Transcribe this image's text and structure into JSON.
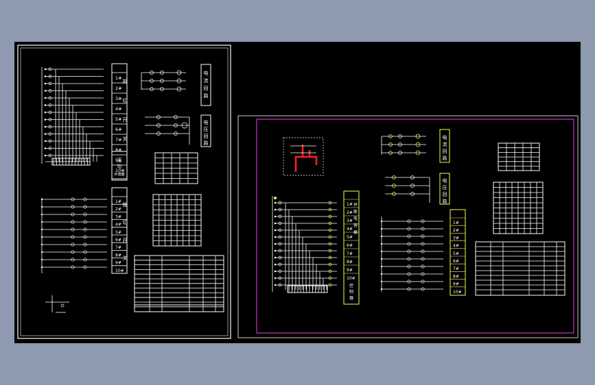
{
  "sheet_left": {
    "bus_rows": 13,
    "contact_rows": 10,
    "current_circuit_label": "电流回路",
    "voltage_circuit_label": "电压回路",
    "switch_label": "无功补偿器",
    "row_labels": [
      "1#",
      "2#",
      "3#",
      "4#",
      "5#",
      "6#",
      "7#",
      "8#",
      "9#",
      "10#"
    ],
    "top_block_chars": [
      "投",
      "切",
      "开",
      "关"
    ],
    "bottom_block_chars": [
      "投",
      "切",
      "开",
      "关"
    ]
  },
  "sheet_right": {
    "bus_rows": 13,
    "contact_rows": 10,
    "current_circuit_label": "电流回路",
    "voltage_circuit_label": "电压回路",
    "vertical_label_a": "并联电容器",
    "vertical_label_b": "控制器",
    "row_labels": [
      "1#",
      "2#",
      "3#",
      "4#",
      "5#",
      "6#",
      "7#",
      "8#",
      "9#",
      "10#"
    ]
  },
  "colors": {
    "page_bg": "#8d9ab0",
    "canvas_bg": "#000000",
    "line": "#ffffff",
    "frame_right": "#cc33cc",
    "accent_yellow": "#ffff55",
    "accent_red": "#ff2020"
  }
}
